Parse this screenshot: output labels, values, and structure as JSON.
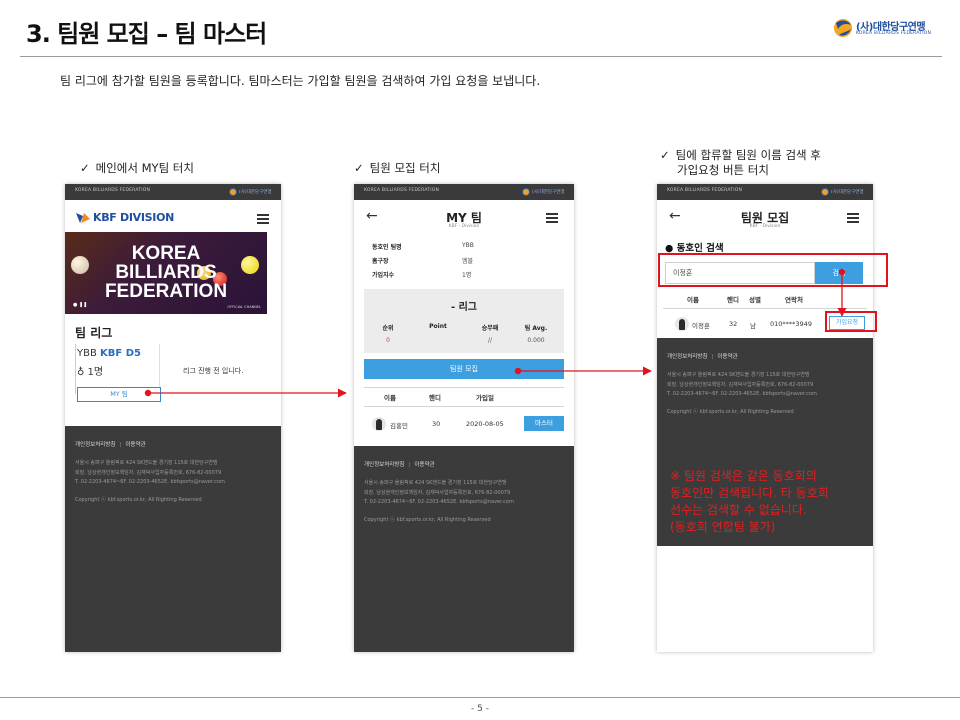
{
  "slide": {
    "title": "3. 팀원 모집 – 팀 마스터",
    "intro": "팀 리그에 참가할 팀원을 등록합니다. 팀마스터는 가입할 팀원을 검색하여 가입 요청을 보냅니다.",
    "page_number": "- 5 -",
    "brand": {
      "kr": "(사)대한당구연맹",
      "en": "KOREA BILLIARDS FEDERATION"
    }
  },
  "steps": [
    {
      "check": "✓",
      "lines": [
        "메인에서 MY팀 터치"
      ]
    },
    {
      "check": "✓",
      "lines": [
        "팀원 모집 터치"
      ]
    },
    {
      "check": "✓",
      "lines": [
        "팀에 합류할 팀원 이름 검색 후",
        "가입요청 버튼 터치"
      ]
    }
  ],
  "common": {
    "topbar_text": "KOREA BILLIARDS FEDERATION",
    "mini_logo_text": "(사)대한당구연맹",
    "footer": {
      "link1": "개인정보처리방침",
      "separator": "|",
      "link2": "이용약관",
      "line1": "서울시 송파구 올림픽로 424 SK핸드볼 경기장 115호 대한당구연맹",
      "line2": "회장, 남상현개인정보책임자, 김재덕사업자등록번호, 676-82-00079",
      "line3": "T. 02-2203-4674~6F. 02-2203-4652E. kbfsports@naver.com",
      "copyright": "Copyright ⓒ kbf.sports.or.kr, All Righting Reserved"
    },
    "icons": {
      "back": "←",
      "menu": "hamburger-menu-icon"
    }
  },
  "phone1": {
    "logo_text": "KBF DIVISION",
    "banner_lines": [
      "KOREA",
      "BILLIARDS",
      "FEDERATION"
    ],
    "banner_controls": "● ❚❚",
    "banner_channel": "OFFICIAL CHANNEL",
    "heading": "팀 리그",
    "team_name": "YBB",
    "division": "KBF D5",
    "member_count": "1명",
    "person_icon": "♁",
    "notice": "리그 진행 전 입니다.",
    "my_team_button": "MY 팀"
  },
  "phone2": {
    "title": "MY 팀",
    "subtitle": "KBF · Division",
    "info": [
      {
        "key": "동호인 팀명",
        "value": "YBB"
      },
      {
        "key": "홈구장",
        "value": "엠블"
      },
      {
        "key": "가입지수",
        "value": "1명"
      }
    ],
    "league_title": "- 리그",
    "stats_headers": [
      "순위",
      "Point",
      "승무패",
      "팀 Avg."
    ],
    "stats_values": [
      "0",
      "",
      "//",
      "0.000"
    ],
    "recruit_button": "팀원 모집",
    "table_headers": [
      "이름",
      "핸디",
      "가입일"
    ],
    "member": {
      "name": "김홍민",
      "handicap": "30",
      "joined": "2020-08-05",
      "role_button": "마스터"
    }
  },
  "phone3": {
    "title": "팀원 모집",
    "subtitle": "KBF · Division",
    "section": "● 동호인 검색",
    "search_value": "이정훈",
    "search_button": "검색",
    "table_headers": [
      "이름",
      "핸디",
      "성별",
      "연락처"
    ],
    "result": {
      "name": "이정훈",
      "handicap": "32",
      "gender": "남",
      "phone": "010****3949",
      "request_button": "가입요청"
    }
  },
  "note_lines": [
    "※ 팀원 검색은 같은 동호회의",
    "동호인만 검색됩니다. 타 동호회",
    "선수는 검색할 수 없습니다.",
    "(동호회 연합팀 불가)"
  ],
  "colors": {
    "accent": "#3d9ee0",
    "annotation_red": "#e0141e",
    "footer_bg": "#3b3b3b",
    "kbf_blue": "#1f4fa0"
  }
}
